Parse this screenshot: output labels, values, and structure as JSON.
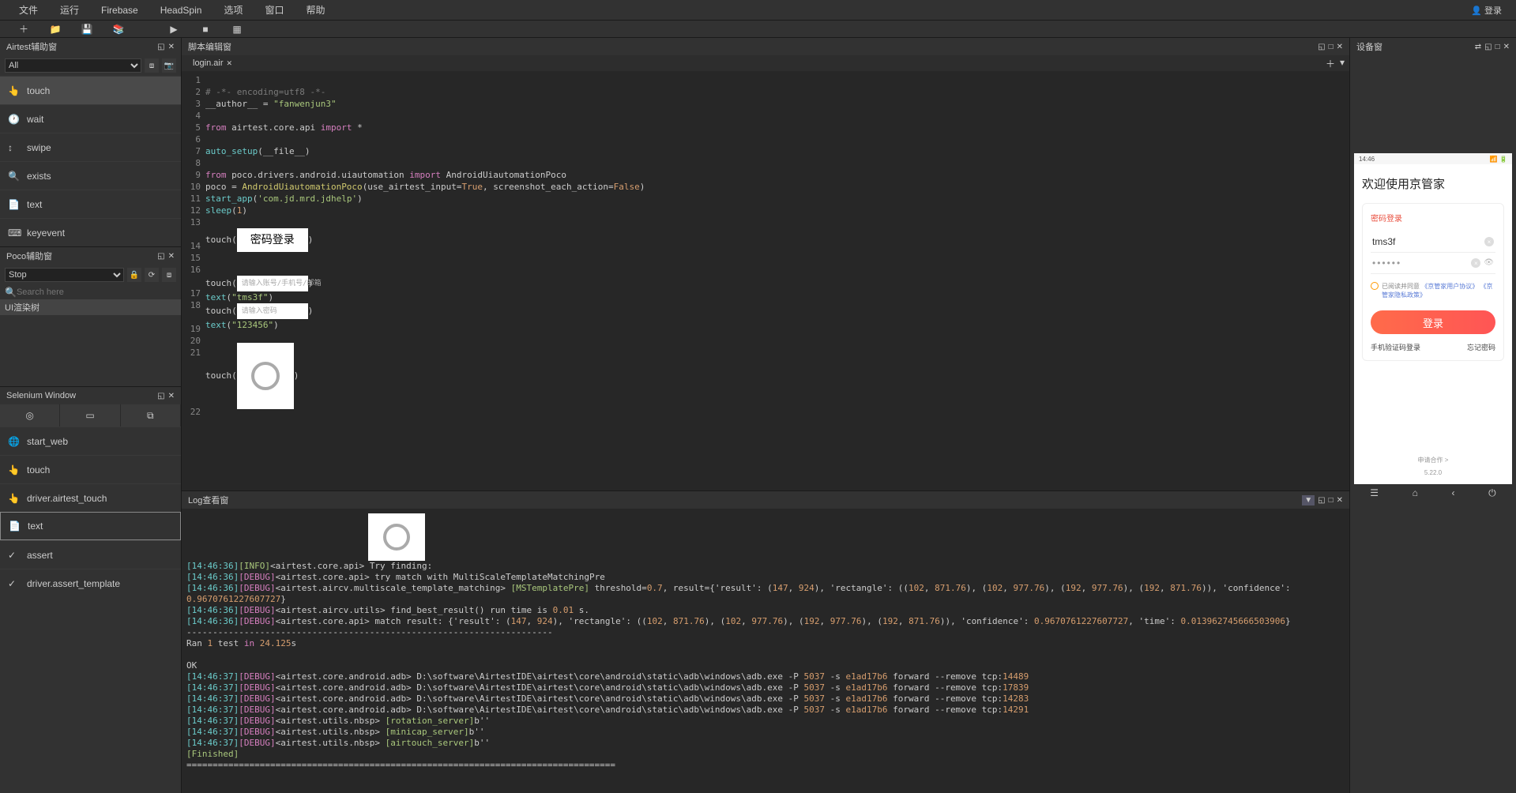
{
  "menubar": {
    "file": "文件",
    "run": "运行",
    "firebase": "Firebase",
    "headspin": "HeadSpin",
    "options": "选项",
    "window": "窗口",
    "help": "帮助",
    "login": "登录"
  },
  "panels": {
    "airtest": "Airtest辅助窗",
    "poco": "Poco辅助窗",
    "selenium": "Selenium Window",
    "editor": "脚本编辑窗",
    "log": "Log查看窗",
    "device": "设备窗"
  },
  "airtest": {
    "select": "All",
    "items": [
      "touch",
      "wait",
      "swipe",
      "exists",
      "text",
      "keyevent"
    ]
  },
  "poco": {
    "select": "Stop",
    "search_placeholder": "Search here",
    "tree": "UI渲染树"
  },
  "selenium": {
    "items": [
      "start_web",
      "touch",
      "driver.airtest_touch",
      "text",
      "assert",
      "driver.assert_template"
    ],
    "active": "text"
  },
  "editor": {
    "tab": "login.air",
    "gutter": [
      "1",
      "2",
      "3",
      "4",
      "5",
      "6",
      "7",
      "8",
      "9",
      "10",
      "11",
      "12",
      "13",
      "",
      "14",
      "15",
      "16",
      "",
      "17",
      "18",
      "",
      "19",
      "20",
      "21",
      "",
      "",
      "",
      "",
      "22"
    ],
    "img_pwd": "密码登录",
    "img_field1": "请输入账号/手机号/邮箱",
    "img_field2": "请输入密码",
    "code": {
      "l1": "# -*- encoding=utf8 -*-",
      "l2a": "__author__ = ",
      "l2b": "\"fanwenjun3\"",
      "l4a": "from",
      "l4b": " airtest.core.api ",
      "l4c": "import",
      "l4d": " *",
      "l6a": "auto_setup",
      "l6b": "(__file__)",
      "l8a": "from",
      "l8b": " poco.drivers.android.uiautomation ",
      "l8c": "import",
      "l8d": " AndroidUiautomationPoco",
      "l9a": "poco = ",
      "l9b": "AndroidUiautomationPoco",
      "l9c": "(use_airtest_input=",
      "l9d": "True",
      "l9e": ", screenshot_each_action=",
      "l9f": "False",
      "l9g": ")",
      "l10a": "start_app",
      "l10b": "(",
      "l10c": "'com.jd.mrd.jdhelp'",
      "l10d": ")",
      "l11a": "sleep",
      "l11b": "(",
      "l11c": "1",
      "l11d": ")",
      "l13": "touch(",
      "l17a": "text",
      "l17b": "(",
      "l17c": "\"tms3f\"",
      "l17d": ")",
      "l19a": "text",
      "l19b": "(",
      "l19c": "\"123456\"",
      "l19d": ")"
    }
  },
  "log": {
    "pre": "[14:46:36][INFO]<airtest.core.api> Try finding: ",
    "l1": "[14:46:36][DEBUG]<airtest.core.api> try match with MultiScaleTemplateMatchingPre",
    "l2": "[14:46:36][DEBUG]<airtest.aircv.multiscale_template_matching> [MSTemplatePre] threshold=0.7, result={'result': (147, 924), 'rectangle': ((102, 871.76), (102, 977.76), (192, 977.76), (192, 871.76)), 'confidence': 0.9670761227607727}",
    "l3": "[14:46:36][DEBUG]<airtest.aircv.utils> find_best_result() run time is 0.01 s.",
    "l4": "[14:46:36][DEBUG]<airtest.core.api> match result: {'result': (147, 924), 'rectangle': ((102, 871.76), (102, 977.76), (192, 977.76), (192, 871.76)), 'confidence': 0.9670761227607727, 'time': 0.013962745666503906}",
    "l5": "----------------------------------------------------------------------",
    "l6": "Ran 1 test in 24.125s",
    "l7": "OK",
    "l8": "[14:46:37][DEBUG]<airtest.core.android.adb> D:\\software\\AirtestIDE\\airtest\\core\\android\\static\\adb\\windows\\adb.exe -P 5037 -s e1ad17b6 forward --remove tcp:14489",
    "l9": "[14:46:37][DEBUG]<airtest.core.android.adb> D:\\software\\AirtestIDE\\airtest\\core\\android\\static\\adb\\windows\\adb.exe -P 5037 -s e1ad17b6 forward --remove tcp:17839",
    "l10": "[14:46:37][DEBUG]<airtest.core.android.adb> D:\\software\\AirtestIDE\\airtest\\core\\android\\static\\adb\\windows\\adb.exe -P 5037 -s e1ad17b6 forward --remove tcp:14283",
    "l11": "[14:46:37][DEBUG]<airtest.core.android.adb> D:\\software\\AirtestIDE\\airtest\\core\\android\\static\\adb\\windows\\adb.exe -P 5037 -s e1ad17b6 forward --remove tcp:14291",
    "l12": "[14:46:37][DEBUG]<airtest.utils.nbsp> [rotation_server]b''",
    "l13": "[14:46:37][DEBUG]<airtest.utils.nbsp> [minicap_server]b''",
    "l14": "[14:46:37][DEBUG]<airtest.utils.nbsp> [airtouch_server]b''",
    "l15": "[Finished]",
    "l16": "=================================================================================="
  },
  "device": {
    "time": "14:46",
    "title": "欢迎使用京管家",
    "tab": "密码登录",
    "username": "tms3f",
    "password": "••••••",
    "terms_pre": "已阅读并同意",
    "terms_l1": "《京管家用户协议》",
    "terms_l2": "《京管家隐私政策》",
    "login": "登录",
    "sms": "手机验证码登录",
    "forgot": "忘记密码",
    "apply": "申请合作 >",
    "version": "5.22.0"
  }
}
